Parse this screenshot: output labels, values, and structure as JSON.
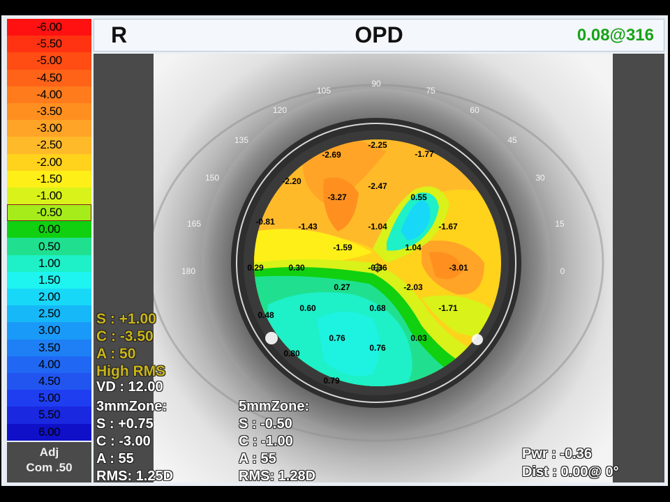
{
  "legend": {
    "items": [
      {
        "label": "-6.00",
        "color": "#ff1111"
      },
      {
        "label": "-5.50",
        "color": "#ff3311"
      },
      {
        "label": "-5.00",
        "color": "#ff4d14"
      },
      {
        "label": "-4.50",
        "color": "#ff6318"
      },
      {
        "label": "-4.00",
        "color": "#ff7b1c"
      },
      {
        "label": "-3.50",
        "color": "#ff9020"
      },
      {
        "label": "-3.00",
        "color": "#ffa426"
      },
      {
        "label": "-2.50",
        "color": "#ffba2a"
      },
      {
        "label": "-2.00",
        "color": "#ffd21c"
      },
      {
        "label": "-1.50",
        "color": "#ffef18"
      },
      {
        "label": "-1.00",
        "color": "#d8f21a"
      },
      {
        "label": "-0.50",
        "color": "#a6ec1a"
      },
      {
        "label": "0.00",
        "color": "#10d010"
      },
      {
        "label": "0.50",
        "color": "#20e090"
      },
      {
        "label": "1.00",
        "color": "#1ef0c8"
      },
      {
        "label": "1.50",
        "color": "#1ef4f0"
      },
      {
        "label": "2.00",
        "color": "#18d8f8"
      },
      {
        "label": "2.50",
        "color": "#16b8f8"
      },
      {
        "label": "3.00",
        "color": "#1a9af8"
      },
      {
        "label": "3.50",
        "color": "#1e80f4"
      },
      {
        "label": "4.00",
        "color": "#2068f4"
      },
      {
        "label": "4.50",
        "color": "#2255f0"
      },
      {
        "label": "5.00",
        "color": "#1e3ef0"
      },
      {
        "label": "5.50",
        "color": "#1a28e0"
      },
      {
        "label": "6.00",
        "color": "#1010c8"
      }
    ],
    "selected_index": 11,
    "footer_line1": "Adj",
    "footer_line2": "Com .50"
  },
  "header": {
    "eye": "R",
    "title": "OPD",
    "rms": "0.08@316"
  },
  "axis_labels": [
    "90",
    "75",
    "60",
    "45",
    "30",
    "15",
    "0",
    "105",
    "120",
    "135",
    "150",
    "165",
    "180"
  ],
  "map_values": [
    "-2.25",
    "-2.69",
    "-1.77",
    "-2.20",
    "-2.47",
    "-3.27",
    "0.55",
    "-0.81",
    "-1.43",
    "-1.04",
    "-1.67",
    "-1.59",
    "1.04",
    "0.29",
    "0.30",
    "-0.36",
    "-3.01",
    "0.27",
    "-2.03",
    "0.60",
    "0.68",
    "-1.71",
    "0.48",
    "0.76",
    "0.03",
    "0.76",
    "0.80",
    "0.79"
  ],
  "refraction": {
    "s": "S :  +1.00",
    "c": "C :  -3.50",
    "a": "A :  50",
    "note": "High RMS",
    "vd": "VD : 12.00"
  },
  "zone3": {
    "title": "3mmZone:",
    "s": "S :  +0.75",
    "c": "C :  -3.00",
    "a": "A :  55",
    "rms": "RMS: 1.25D"
  },
  "zone5": {
    "title": "5mmZone:",
    "s": "S :  -0.50",
    "c": "C :  -1.00",
    "a": "A :  55",
    "rms": "RMS: 1.28D"
  },
  "cursor": {
    "pwr": "Pwr :  -0.36",
    "dist": "Dist :  0.00@  0°"
  }
}
